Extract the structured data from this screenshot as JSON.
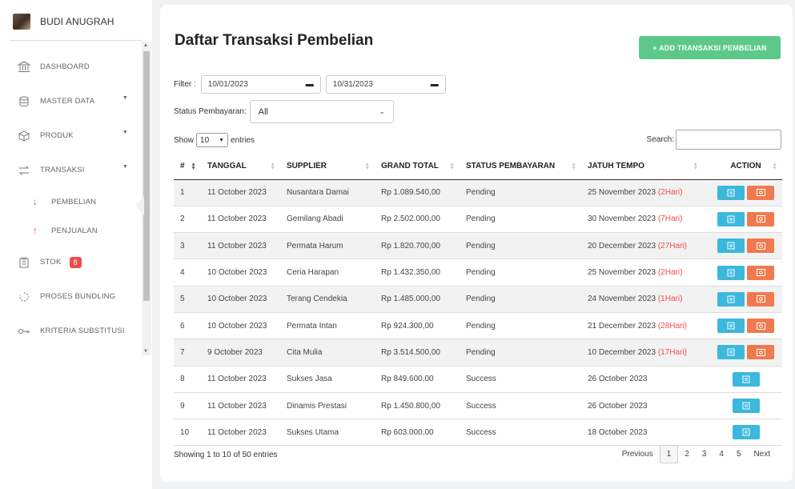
{
  "user": {
    "name": "BUDI ANUGRAH"
  },
  "menu": {
    "dashboard": "DASHBOARD",
    "master_data": "MASTER DATA",
    "produk": "PRODUK",
    "transaksi": "TRANSAKSI",
    "pembelian": "PEMBELIAN",
    "penjualan": "PENJUALAN",
    "stok": "STOK",
    "stok_badge": "8",
    "proses_bundling": "PROSES BUNDLING",
    "kriteria_substitusi": "KRITERIA SUBSTITUSI"
  },
  "page": {
    "title": "Daftar Transaksi Pembelian",
    "add_button": "+ ADD TRANSAKSI PEMBELIAN"
  },
  "filter": {
    "label": "Filter :",
    "date_from": "10/01/2023",
    "date_to": "10/31/2023",
    "status_label": "Status Pembayaran:",
    "status_value": "All"
  },
  "table_controls": {
    "show_label": "Show",
    "entries_value": "10",
    "entries_label": "entries",
    "search_label": "Search:"
  },
  "table": {
    "headers": [
      "#",
      "TANGGAL",
      "SUPPLIER",
      "GRAND TOTAL",
      "STATUS PEMBAYARAN",
      "JATUH TEMPO",
      "ACTION"
    ],
    "rows": [
      {
        "no": "1",
        "tanggal": "11 October 2023",
        "supplier": "Nusantara Damai",
        "total": "Rp 1.089.540,00",
        "status": "Pending",
        "tempo": "25 November 2023 ",
        "hari": "(2Hari)"
      },
      {
        "no": "2",
        "tanggal": "11 October 2023",
        "supplier": "Gemilang Abadi",
        "total": "Rp 2.502.000,00",
        "status": "Pending",
        "tempo": "30 November 2023 ",
        "hari": "(7Hari)"
      },
      {
        "no": "3",
        "tanggal": "11 October 2023",
        "supplier": "Permata Harum",
        "total": "Rp 1.820.700,00",
        "status": "Pending",
        "tempo": "20 December 2023 ",
        "hari": "(27Hari)"
      },
      {
        "no": "4",
        "tanggal": "10 October 2023",
        "supplier": "Ceria Harapan",
        "total": "Rp 1.432.350,00",
        "status": "Pending",
        "tempo": "25 November 2023 ",
        "hari": "(2Hari)"
      },
      {
        "no": "5",
        "tanggal": "10 October 2023",
        "supplier": "Terang Cendekia",
        "total": "Rp 1.485.000,00",
        "status": "Pending",
        "tempo": "24 November 2023 ",
        "hari": "(1Hari)"
      },
      {
        "no": "6",
        "tanggal": "10 October 2023",
        "supplier": "Permata Intan",
        "total": "Rp 924.300,00",
        "status": "Pending",
        "tempo": "21 December 2023 ",
        "hari": "(28Hari)"
      },
      {
        "no": "7",
        "tanggal": "9 October 2023",
        "supplier": "Cita Mulia",
        "total": "Rp 3.514.500,00",
        "status": "Pending",
        "tempo": "10 December 2023 ",
        "hari": "(17Hari)"
      },
      {
        "no": "8",
        "tanggal": "11 October 2023",
        "supplier": "Sukses Jasa",
        "total": "Rp 849.600,00",
        "status": "Success",
        "tempo": "26 October 2023",
        "hari": ""
      },
      {
        "no": "9",
        "tanggal": "11 October 2023",
        "supplier": "Dinamis Prestasi",
        "total": "Rp 1.450.800,00",
        "status": "Success",
        "tempo": "26 October 2023",
        "hari": ""
      },
      {
        "no": "10",
        "tanggal": "11 October 2023",
        "supplier": "Sukses Utama",
        "total": "Rp 603.000,00",
        "status": "Success",
        "tempo": "18 October 2023",
        "hari": ""
      }
    ]
  },
  "footer": {
    "info": "Showing 1 to 10 of 50 entries",
    "previous": "Previous",
    "pages": [
      "1",
      "2",
      "3",
      "4",
      "5"
    ],
    "next": "Next"
  }
}
